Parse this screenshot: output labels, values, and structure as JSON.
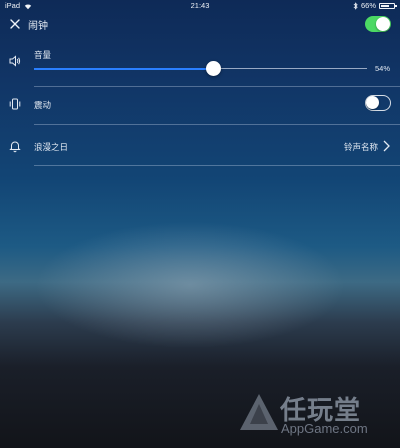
{
  "status_bar": {
    "device": "iPad",
    "time": "21:43",
    "battery": "66%",
    "battery_level": 0.66
  },
  "header": {
    "title": "闹钟",
    "alarm_enabled": true
  },
  "volume": {
    "label": "音量",
    "value": 0.54,
    "value_text": "54%"
  },
  "vibration": {
    "label": "震动",
    "enabled": false
  },
  "ringtone": {
    "name": "浪漫之日",
    "action_label": "铃声名称"
  },
  "watermark": {
    "cn": "任玩堂",
    "en": "AppGame.com"
  },
  "colors": {
    "accent": "#2a7fff",
    "toggle_on": "#4cd964"
  },
  "icons": [
    "wifi-icon",
    "bluetooth-icon",
    "battery-icon",
    "close-icon",
    "speaker-icon",
    "vibrate-icon",
    "bell-icon",
    "chevron-right-icon"
  ]
}
